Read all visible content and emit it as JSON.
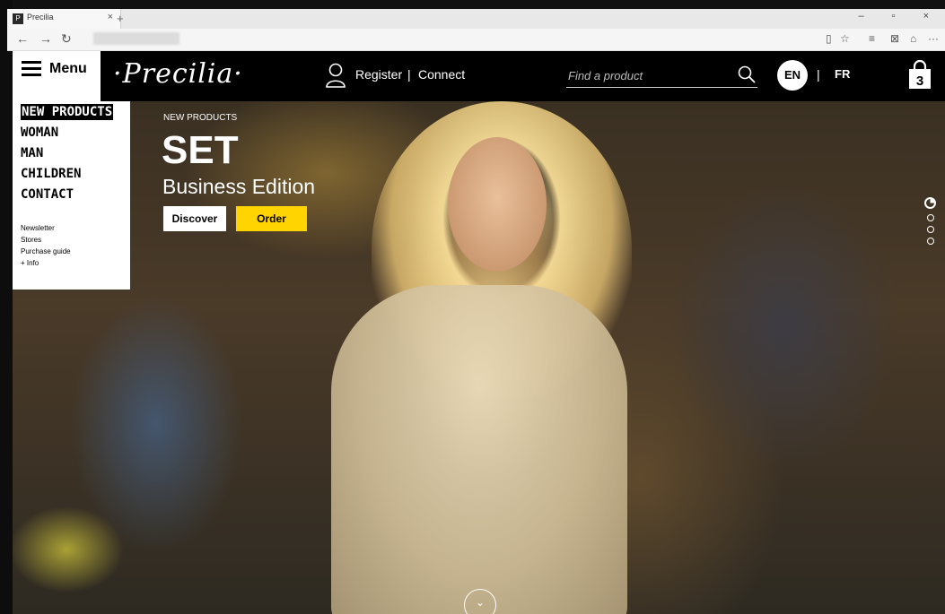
{
  "browser": {
    "tab_title": "Precilia",
    "tab_favicon": "P",
    "tab_close": "×",
    "new_tab": "+",
    "window_controls": "–  ▫  ×",
    "nav_back": "←",
    "nav_forward": "→",
    "nav_refresh": "↻",
    "right_icons": [
      "▯",
      "☆",
      "≡",
      "⊠",
      "⌂",
      "···"
    ]
  },
  "header": {
    "menu_label": "Menu",
    "logo": "·Precilia·",
    "register": "Register",
    "separator": "|",
    "connect": "Connect",
    "search_placeholder": "Find a product",
    "lang_active": "EN",
    "lang_separator": "|",
    "lang_other": "FR",
    "cart_count": "3"
  },
  "menu": {
    "primary": [
      "NEW PRODUCTS",
      "WOMAN",
      "MAN",
      "CHILDREN",
      "CONTACT"
    ],
    "active_index": 0,
    "secondary": [
      "Newsletter",
      "Stores",
      "Purchase guide",
      "+ Info"
    ]
  },
  "hero": {
    "eyebrow": "NEW PRODUCTS",
    "title": "SET",
    "subtitle": "Business Edition",
    "discover_label": "Discover",
    "order_label": "Order",
    "slide_count": 4,
    "active_slide": 0,
    "scroll_icon": "⌄"
  },
  "colors": {
    "accent": "#ffd400",
    "header_bg": "#000000",
    "menu_bg": "#ffffff"
  }
}
